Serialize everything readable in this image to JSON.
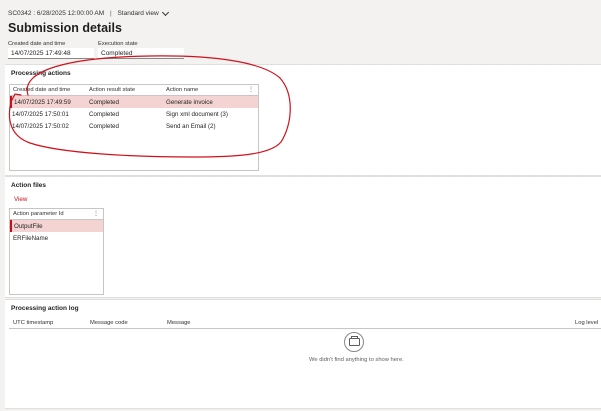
{
  "breadcrumb": {
    "record": "SC0342 : 6/28/2025 12:00:00 AM",
    "separator": "|",
    "view": "Standard view"
  },
  "page_title": "Submission details",
  "fields": {
    "created_label": "Created date and time",
    "created_value": "14/07/2025 17:49:48",
    "state_label": "Execution state",
    "state_value": "Completed"
  },
  "processing_actions": {
    "title": "Processing actions",
    "columns": [
      "Created date and time",
      "Action result state",
      "Action name"
    ],
    "rows": [
      {
        "created": "14/07/2025 17:49:59",
        "state": "Completed",
        "name": "Generate invoice"
      },
      {
        "created": "14/07/2025 17:50:01",
        "state": "Completed",
        "name": "Sign xml document (3)"
      },
      {
        "created": "14/07/2025 17:50:02",
        "state": "Completed",
        "name": "Send an Email (2)"
      }
    ],
    "more_icon": "vertical-ellipsis-icon"
  },
  "action_files": {
    "title": "Action files",
    "view_link": "View",
    "column": "Action parameter Id",
    "rows": [
      "OutputFile",
      "ERFileName"
    ]
  },
  "action_log": {
    "title": "Processing action log",
    "columns": [
      "UTC timestamp",
      "Message code",
      "Message",
      "Log level"
    ],
    "empty_text": "We didn't find anything to show here.",
    "empty_icon": "empty-box-icon"
  },
  "colors": {
    "selection": "#f3d4d2",
    "accent": "#c50f1f",
    "annotation": "#d2111b"
  }
}
